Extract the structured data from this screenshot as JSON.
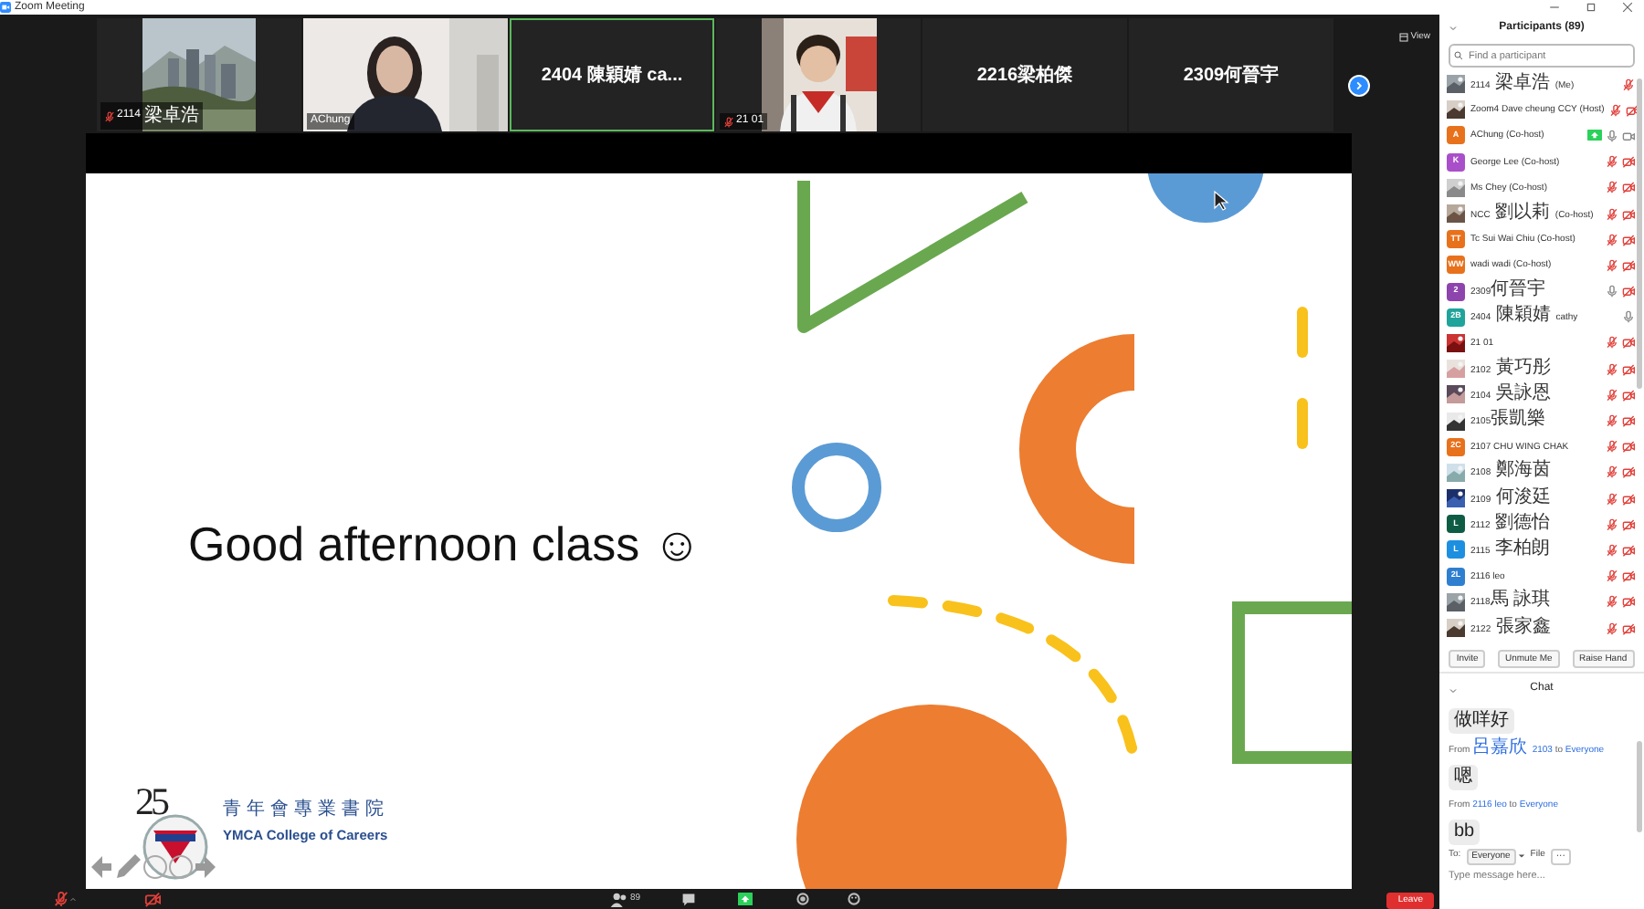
{
  "window": {
    "title": "Zoom Meeting"
  },
  "video_strip": {
    "view_label": "View",
    "tiles": [
      {
        "kind": "picture",
        "label": "2114 梁卓浩",
        "muted": true,
        "active": false
      },
      {
        "kind": "picture",
        "label": "AChung",
        "muted": false,
        "active": false
      },
      {
        "kind": "name",
        "label": "2404 陳穎婧 ca...",
        "active": true
      },
      {
        "kind": "picture",
        "label": "21 01",
        "muted": true,
        "active": false
      },
      {
        "kind": "name",
        "label": "2216梁柏傑",
        "active": false
      },
      {
        "kind": "name",
        "label": "2309何晉宇",
        "active": false
      }
    ]
  },
  "slide": {
    "greeting": "Good afternoon class ☺",
    "logo": {
      "number": "25",
      "name_zh": "青年會專業書院",
      "name_en": "YMCA College of Careers"
    }
  },
  "toolbar": {
    "mic_muted": true,
    "video_off": true,
    "participant_count": "89",
    "sharing": true,
    "leave": "Leave"
  },
  "participants": {
    "title": "Participants (89)",
    "search_placeholder": "Find a participant",
    "items": [
      {
        "name": "2114 梁卓浩 (Me)",
        "mic_muted": true,
        "sharing": false
      },
      {
        "name": "Zoom4 Dave cheung CCY (Host)",
        "mic_muted": true,
        "video_off": true,
        "sharing": false
      },
      {
        "name": "AChung (Co-host)",
        "avatar": {
          "kind": "initials",
          "text": "A",
          "color": "#e8711c"
        },
        "mic_muted": false,
        "video_off": false,
        "sharing": true
      },
      {
        "name": "George Lee (Co-host)",
        "avatar": {
          "kind": "initials",
          "text": "K",
          "color": "#a94fc9"
        },
        "mic_muted": true,
        "video_off": true,
        "sharing": false
      },
      {
        "name": "Ms Chey (Co-host)",
        "mic_muted": true,
        "video_off": true,
        "sharing": false
      },
      {
        "name": "NCC 劉以莉 (Co-host)",
        "mic_muted": true,
        "video_off": true,
        "sharing": false
      },
      {
        "name": "Tc Sui Wai Chiu (Co-host)",
        "avatar": {
          "kind": "initials",
          "text": "TT",
          "color": "#e8711c"
        },
        "mic_muted": true,
        "video_off": true,
        "sharing": false
      },
      {
        "name": "wadi wadi (Co-host)",
        "avatar": {
          "kind": "initials",
          "text": "WW",
          "color": "#e8711c"
        },
        "mic_muted": true,
        "video_off": true,
        "sharing": false
      },
      {
        "name": "2309何晉宇",
        "avatar": {
          "kind": "initials",
          "text": "2",
          "color": "#8e44ad"
        },
        "mic_muted": false,
        "video_off": true,
        "sharing": false
      },
      {
        "name": "2404 陳穎婧 cathy",
        "avatar": {
          "kind": "initials",
          "text": "2B",
          "color": "#1fa39a"
        },
        "mic_muted": false,
        "sharing": false
      },
      {
        "name": "21 01",
        "mic_muted": true,
        "video_off": true,
        "sharing": false
      },
      {
        "name": "2102 黃巧彤",
        "mic_muted": true,
        "video_off": true,
        "sharing": false
      },
      {
        "name": "2104 吳詠恩",
        "mic_muted": true,
        "video_off": true,
        "sharing": false
      },
      {
        "name": "2105張凱樂",
        "mic_muted": true,
        "video_off": true,
        "sharing": false
      },
      {
        "name": "2107 CHU WING CHAK",
        "avatar": {
          "kind": "initials",
          "text": "2C",
          "color": "#e8711c"
        },
        "mic_muted": true,
        "video_off": true,
        "sharing": false
      },
      {
        "name": "2108 鄭海茵",
        "mic_muted": true,
        "video_off": true,
        "sharing": false
      },
      {
        "name": "2109 何浚廷",
        "mic_muted": true,
        "video_off": true,
        "sharing": false
      },
      {
        "name": "2112 劉德怡",
        "avatar": {
          "kind": "initials",
          "text": "L",
          "color": "#0f5c45"
        },
        "mic_muted": true,
        "video_off": true,
        "sharing": false
      },
      {
        "name": "2115 李柏朗",
        "avatar": {
          "kind": "initials",
          "text": "L",
          "color": "#1d8fe0"
        },
        "mic_muted": true,
        "video_off": true,
        "sharing": false
      },
      {
        "name": "2116 leo",
        "avatar": {
          "kind": "initials",
          "text": "2L",
          "color": "#2f7fd0"
        },
        "mic_muted": true,
        "video_off": true,
        "sharing": false
      },
      {
        "name": "2118馬 詠琪",
        "mic_muted": true,
        "video_off": true,
        "sharing": false
      },
      {
        "name": "2122 張家鑫",
        "mic_muted": true,
        "video_off": true,
        "sharing": false
      }
    ],
    "buttons": [
      "Invite",
      "Unmute Me",
      "Raise Hand"
    ]
  },
  "chat": {
    "title": "Chat",
    "messages": [
      {
        "text": "做咩好"
      },
      {
        "from_word": "From",
        "sender": "呂嘉欣 2103",
        "to_word": "to",
        "recipient": "Everyone",
        "text": "嗯"
      },
      {
        "from_word": "From",
        "sender": "2116 leo",
        "to_word": "to",
        "recipient": "Everyone",
        "text": "bb"
      }
    ],
    "to_label": "To:",
    "recipient": "Everyone",
    "file": "File",
    "more": "···",
    "placeholder": "Type message here..."
  }
}
